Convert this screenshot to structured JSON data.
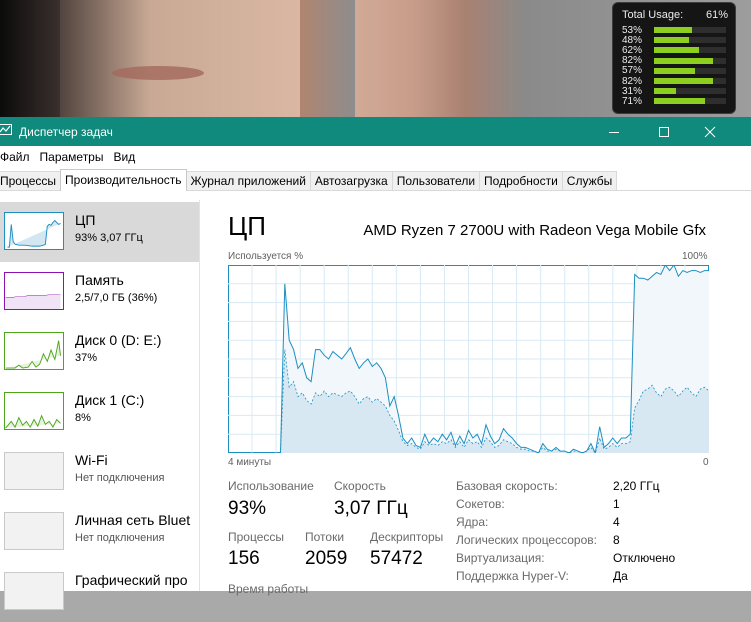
{
  "gadget": {
    "label": "Total Usage:",
    "total": "61%",
    "cores": [
      {
        "text": "53%",
        "value": 53
      },
      {
        "text": "48%",
        "value": 48
      },
      {
        "text": "62%",
        "value": 62
      },
      {
        "text": "82%",
        "value": 82
      },
      {
        "text": "57%",
        "value": 57
      },
      {
        "text": "82%",
        "value": 82
      },
      {
        "text": "31%",
        "value": 31
      },
      {
        "text": "71%",
        "value": 71
      }
    ]
  },
  "window": {
    "title": "Диспетчер задач",
    "menu": [
      "Файл",
      "Параметры",
      "Вид"
    ],
    "tabs": [
      "Процессы",
      "Производительность",
      "Журнал приложений",
      "Автозагрузка",
      "Пользователи",
      "Подробности",
      "Службы"
    ],
    "active_tab": 1
  },
  "sidebar": [
    {
      "name": "ЦП",
      "sub": "93% 3,07 ГГц",
      "color": "#1c8fc2"
    },
    {
      "name": "Память",
      "sub": "2,5/7,0 ГБ (36%)",
      "color": "#8b12ae"
    },
    {
      "name": "Диск 0 (D: E:)",
      "sub": "37%",
      "color": "#4da61b"
    },
    {
      "name": "Диск 1 (C:)",
      "sub": "8%",
      "color": "#4da61b"
    },
    {
      "name": "Wi-Fi",
      "sub": "Нет подключения",
      "color": "#a74f01"
    },
    {
      "name": "Личная сеть Bluet",
      "sub": "Нет подключения",
      "color": "#a74f01"
    },
    {
      "name": "Графический про",
      "sub": "",
      "color": "#1c8fc2"
    }
  ],
  "main": {
    "title": "ЦП",
    "model": "AMD Ryzen 7 2700U with Radeon Vega Mobile Gfx",
    "used_label": "Используется %",
    "max_label": "100%",
    "time_label": "4 минуты",
    "zero_label": "0",
    "stats": {
      "usage_label": "Использование",
      "usage": "93%",
      "speed_label": "Скорость",
      "speed": "3,07 ГГц",
      "proc_label": "Процессы",
      "proc": "156",
      "threads_label": "Потоки",
      "threads": "2059",
      "handles_label": "Дескрипторы",
      "handles": "57472",
      "uptime_label": "Время работы"
    },
    "specs": [
      {
        "k": "Базовая скорость:",
        "v": "2,20 ГГц"
      },
      {
        "k": "Сокетов:",
        "v": "1"
      },
      {
        "k": "Ядра:",
        "v": "4"
      },
      {
        "k": "Логических процессоров:",
        "v": "8"
      },
      {
        "k": "Виртуализация:",
        "v": "Отключено"
      },
      {
        "k": "Поддержка Hyper-V:",
        "v": "Да"
      }
    ],
    "accent": "#1c8fc2"
  },
  "chart_data": {
    "type": "area",
    "x_range_label": "4 минуты",
    "ylim": [
      0,
      100
    ],
    "series": [
      {
        "values": [
          0,
          0,
          0,
          0,
          0,
          0,
          0,
          0,
          0,
          0,
          0,
          0,
          0,
          90,
          60,
          55,
          45,
          48,
          40,
          38,
          55,
          55,
          52,
          50,
          54,
          52,
          50,
          53,
          56,
          50,
          45,
          48,
          50,
          46,
          48,
          45,
          40,
          25,
          30,
          20,
          8,
          5,
          8,
          4,
          3,
          10,
          5,
          8,
          6,
          10,
          7,
          11,
          4,
          9,
          5,
          12,
          8,
          10,
          5,
          15,
          9,
          5,
          7,
          13,
          10,
          8,
          5,
          3,
          3,
          2,
          1,
          0,
          5,
          2,
          1,
          3,
          1,
          1,
          0,
          2,
          1,
          0,
          1,
          5,
          0,
          14,
          3,
          5,
          8,
          5,
          8,
          8,
          10,
          95,
          93,
          93,
          92,
          94,
          96,
          95,
          100,
          97,
          100,
          94,
          97,
          96,
          97,
          97,
          96,
          97,
          97
        ]
      },
      {
        "values": [
          0,
          0,
          0,
          0,
          0,
          0,
          0,
          0,
          0,
          0,
          0,
          0,
          0,
          55,
          35,
          38,
          30,
          32,
          28,
          26,
          32,
          30,
          33,
          30,
          32,
          31,
          30,
          32,
          33,
          30,
          26,
          29,
          30,
          27,
          29,
          27,
          25,
          20,
          17,
          12,
          6,
          4,
          5,
          3,
          2,
          6,
          4,
          5,
          4,
          6,
          5,
          7,
          3,
          6,
          3,
          7,
          5,
          6,
          3,
          8,
          6,
          3,
          4,
          7,
          6,
          5,
          3,
          2,
          2,
          1,
          1,
          0,
          3,
          1,
          1,
          2,
          1,
          1,
          0,
          1,
          1,
          0,
          1,
          3,
          0,
          8,
          2,
          3,
          5,
          3,
          5,
          5,
          6,
          24,
          28,
          33,
          34,
          36,
          32,
          30,
          34,
          35,
          33,
          30,
          33,
          35,
          32,
          30,
          34,
          35,
          33
        ]
      }
    ]
  }
}
